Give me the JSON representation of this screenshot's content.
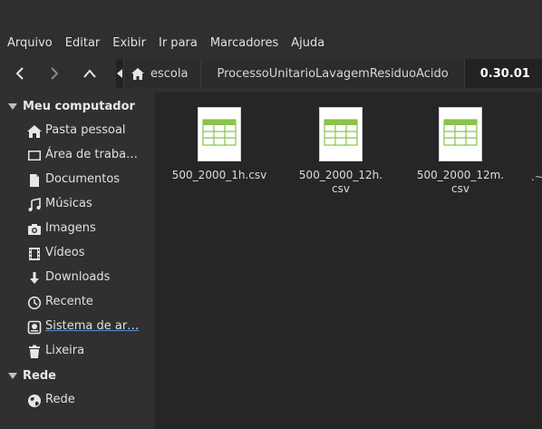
{
  "menubar": {
    "items": [
      "Arquivo",
      "Editar",
      "Exibir",
      "Ir para",
      "Marcadores",
      "Ajuda"
    ]
  },
  "toolbar": {
    "back_icon": "chevron-left-icon",
    "forward_icon": "chevron-right-icon",
    "up_icon": "chevron-up-icon"
  },
  "pathbar": {
    "crumbs": [
      "escola",
      "ProcessoUnitarioLavagemResiduoAcido",
      "0.30.01"
    ]
  },
  "sidebar": {
    "sections": [
      {
        "title": "Meu computador",
        "items": [
          {
            "label": "Pasta pessoal",
            "icon": "home-icon"
          },
          {
            "label": "Área de traba…",
            "icon": "desktop-icon"
          },
          {
            "label": "Documentos",
            "icon": "document-icon"
          },
          {
            "label": "Músicas",
            "icon": "music-icon"
          },
          {
            "label": "Imagens",
            "icon": "camera-icon"
          },
          {
            "label": "Vídeos",
            "icon": "film-icon"
          },
          {
            "label": "Downloads",
            "icon": "download-icon"
          },
          {
            "label": "Recente",
            "icon": "clock-icon"
          },
          {
            "label": "Sistema de ar…",
            "icon": "harddisk-icon"
          },
          {
            "label": "Lixeira",
            "icon": "trash-icon"
          }
        ]
      },
      {
        "title": "Rede",
        "items": [
          {
            "label": "Rede",
            "icon": "network-icon"
          }
        ]
      }
    ]
  },
  "files": [
    {
      "name": "500_2000_1h.csv",
      "icon": "spreadsheet-icon"
    },
    {
      "name": "500_2000_12h.\ncsv",
      "icon": "spreadsheet-icon"
    },
    {
      "name": "500_2000_12m.\ncsv",
      "icon": "spreadsheet-icon"
    }
  ],
  "files_overflow": ".~",
  "colors": {
    "background": "#2b2b2b",
    "content_bg": "#262626",
    "sidebar_bg": "#303030",
    "spreadsheet_green": "#8bc34a",
    "accent_underline": "#4a90d9"
  }
}
